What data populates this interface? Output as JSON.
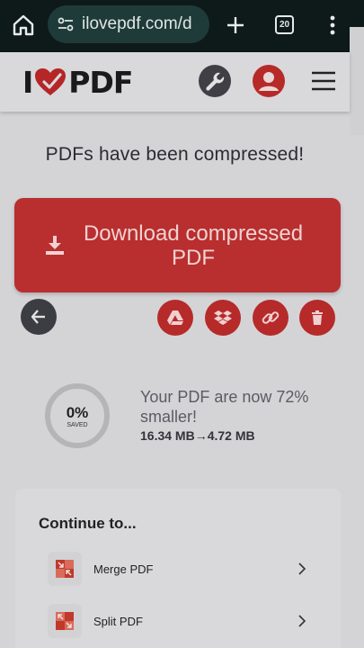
{
  "browser": {
    "url": "ilovepdf.com/d",
    "tab_count": "20"
  },
  "site": {
    "logo_left": "I",
    "logo_right": "PDF"
  },
  "status": {
    "title": "PDFs have been compressed!"
  },
  "download": {
    "label": "Download compressed PDF"
  },
  "result": {
    "percent_label": "0%",
    "saved_label": "SAVED",
    "message": "Your PDF are now 72% smaller!",
    "original_size": "16.34 MB",
    "arrow": "→",
    "new_size": "4.72 MB"
  },
  "continue": {
    "title": "Continue to...",
    "items": [
      {
        "label": "Merge PDF",
        "icon": "merge-icon"
      },
      {
        "label": "Split PDF",
        "icon": "split-icon"
      }
    ]
  },
  "colors": {
    "brand_red": "#b92e2e",
    "browser_bar": "#0e1a19",
    "url_pill": "#1e3b39"
  }
}
